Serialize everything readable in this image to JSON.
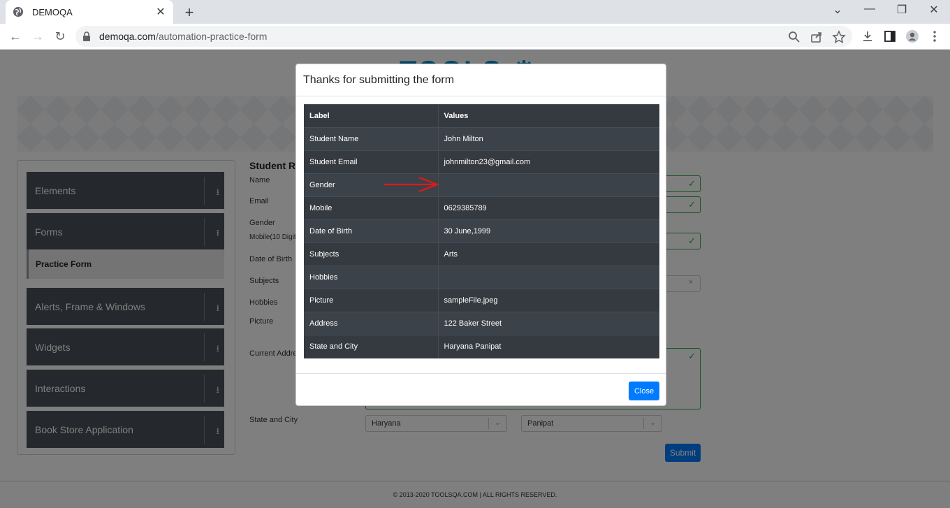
{
  "browser": {
    "tab_title": "DEMOQA",
    "new_tab_symbol": "+",
    "close_symbol": "✕",
    "url_host": "demoqa.com",
    "url_path": "/automation-practice-form"
  },
  "sidebar": {
    "groups": [
      {
        "label": "Elements"
      },
      {
        "label": "Forms"
      },
      {
        "label": "Alerts, Frame & Windows"
      },
      {
        "label": "Widgets"
      },
      {
        "label": "Interactions"
      },
      {
        "label": "Book Store Application"
      }
    ],
    "active_item": "Practice Form"
  },
  "form": {
    "title": "Student Re",
    "labels": {
      "name": "Name",
      "email": "Email",
      "gender": "Gender",
      "mobile": "Mobile(10 Digit",
      "dob": "Date of Birth",
      "subjects": "Subjects",
      "hobbies": "Hobbies",
      "picture": "Picture",
      "address": "Current Addre",
      "state_city": "State and City"
    },
    "state_value": "Haryana",
    "city_value": "Panipat",
    "submit_label": "Submit"
  },
  "footer": {
    "text": "© 2013-2020 TOOLSQA.COM | ALL RIGHTS RESERVED."
  },
  "modal": {
    "title": "Thanks for submitting the form",
    "headers": [
      "Label",
      "Values"
    ],
    "rows": [
      {
        "label": "Student Name",
        "value": "John Milton"
      },
      {
        "label": "Student Email",
        "value": "johnmilton23@gmail.com"
      },
      {
        "label": "Gender",
        "value": ""
      },
      {
        "label": "Mobile",
        "value": "0629385789"
      },
      {
        "label": "Date of Birth",
        "value": "30 June,1999"
      },
      {
        "label": "Subjects",
        "value": "Arts"
      },
      {
        "label": "Hobbies",
        "value": ""
      },
      {
        "label": "Picture",
        "value": "sampleFile.jpeg"
      },
      {
        "label": "Address",
        "value": "122 Baker Street"
      },
      {
        "label": "State and City",
        "value": "Haryana Panipat"
      }
    ],
    "close_label": "Close"
  },
  "colors": {
    "primary": "#007bff",
    "table_dark": "#343a40",
    "annotation_arrow": "#e0191a",
    "valid_green": "#28a745"
  }
}
